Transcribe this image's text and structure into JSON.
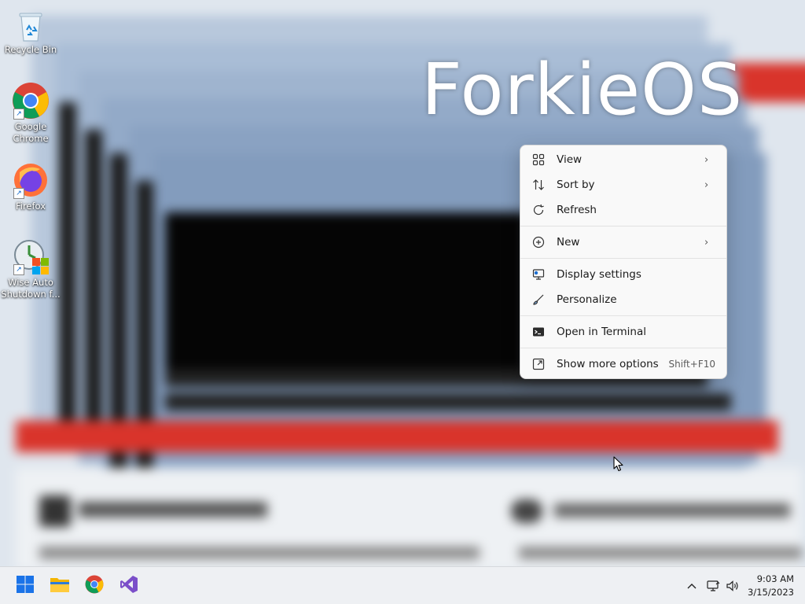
{
  "desktop": {
    "watermark": "ForkieOS",
    "icons": [
      {
        "label": "Recycle Bin",
        "icon": "recycle-bin-icon"
      },
      {
        "label": "Google Chrome",
        "icon": "chrome-icon"
      },
      {
        "label": "Firefox",
        "icon": "firefox-icon"
      },
      {
        "label": "Wise Auto Shutdown f...",
        "icon": "wise-auto-shutdown-icon"
      }
    ]
  },
  "context_menu": {
    "items": [
      {
        "label": "View",
        "icon": "view-grid-icon",
        "has_submenu": true
      },
      {
        "label": "Sort by",
        "icon": "sort-icon",
        "has_submenu": true
      },
      {
        "label": "Refresh",
        "icon": "refresh-icon",
        "has_submenu": false
      },
      {
        "label": "New",
        "icon": "new-plus-icon",
        "has_submenu": true
      },
      {
        "label": "Display settings",
        "icon": "display-settings-icon",
        "has_submenu": false
      },
      {
        "label": "Personalize",
        "icon": "personalize-brush-icon",
        "has_submenu": false
      },
      {
        "label": "Open in Terminal",
        "icon": "terminal-icon",
        "has_submenu": false
      },
      {
        "label": "Show more options",
        "icon": "show-more-options-icon",
        "has_submenu": false,
        "shortcut": "Shift+F10"
      }
    ]
  },
  "taskbar": {
    "pinned": [
      {
        "name": "Start",
        "icon": "windows-start-icon"
      },
      {
        "name": "File Explorer",
        "icon": "file-explorer-icon"
      },
      {
        "name": "Google Chrome",
        "icon": "chrome-icon"
      },
      {
        "name": "Visual Studio",
        "icon": "visual-studio-icon"
      }
    ],
    "tray": {
      "icons": [
        "chevron-up-icon",
        "network-icon",
        "volume-icon"
      ],
      "time": "9:03 AM",
      "date": "3/15/2023"
    }
  },
  "colors": {
    "accent_red": "#d9342b",
    "menu_bg": "#f9f9f9",
    "taskbar_bg": "#eef0f3"
  }
}
